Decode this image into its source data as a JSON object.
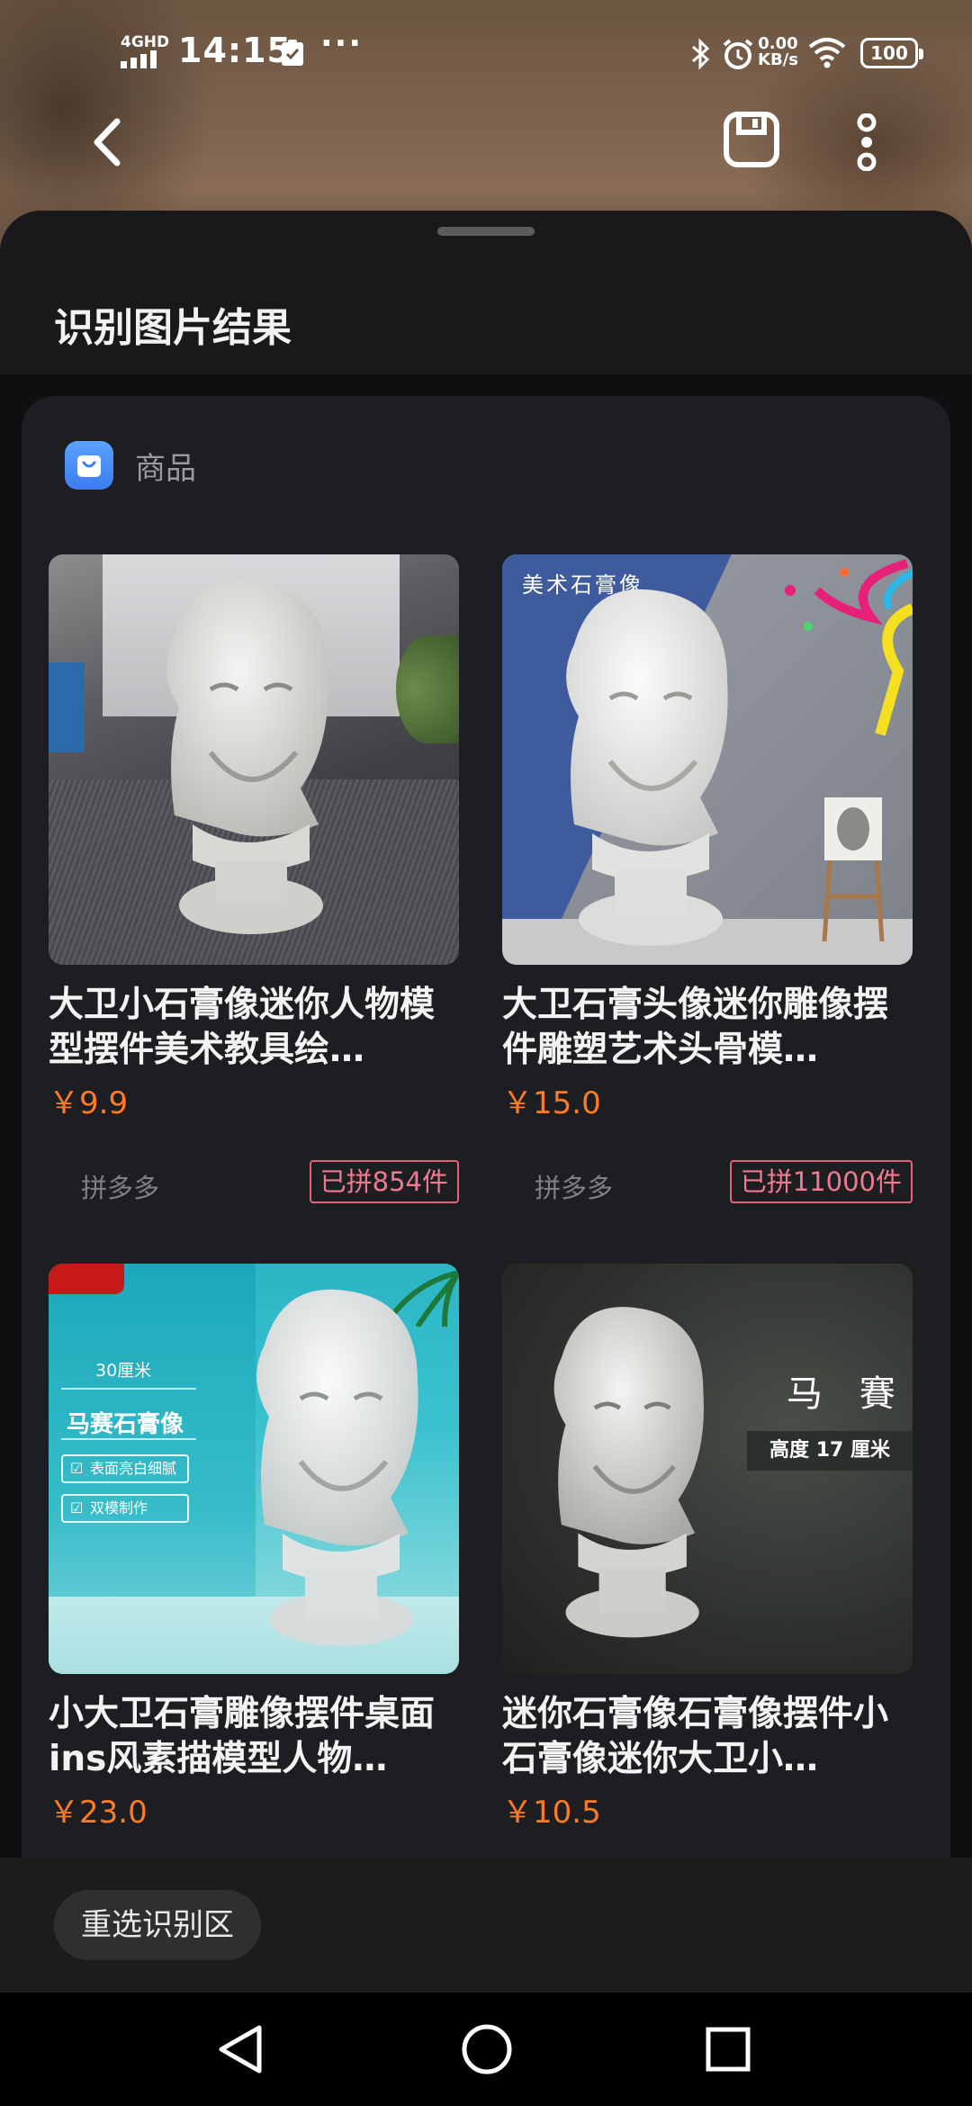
{
  "status_bar": {
    "network": "4GHD",
    "time": "14:15",
    "more": "···",
    "speed_value": "0.00",
    "speed_unit": "KB/s",
    "battery": "100"
  },
  "top_bar": {
    "back_icon": "chevron-left-icon",
    "save_icon": "save-icon",
    "more_icon": "more-vertical-icon"
  },
  "sheet": {
    "title": "识别图片结果",
    "category": {
      "icon": "shopping-bag-icon",
      "label": "商品"
    }
  },
  "products": [
    {
      "title": "大卫小石膏像迷你人物模型摆件美术教具绘…",
      "price": "￥9.9",
      "platform": "拼多多",
      "sold": "已拼854件"
    },
    {
      "title": "大卫石膏头像迷你雕像摆件雕塑艺术头骨模…",
      "price": "￥15.0",
      "platform": "拼多多",
      "sold": "已拼11000件",
      "image_text": "美术石膏像"
    },
    {
      "title": "小大卫石膏雕像摆件桌面ins风素描模型人物…",
      "price": "￥23.0",
      "image_text": {
        "size": "30厘米",
        "name": "马赛石膏像",
        "feature1": "表面亮白细腻",
        "feature2": "双模制作"
      }
    },
    {
      "title": "迷你石膏像石膏像摆件小石膏像迷你大卫小…",
      "price": "￥10.5",
      "image_text": {
        "name": "马 賽",
        "height": "高度 17 厘米"
      }
    }
  ],
  "bottom": {
    "reselect_label": "重选识别区"
  },
  "nav_bar": {
    "back_icon": "triangle-back-icon",
    "home_icon": "circle-home-icon",
    "recent_icon": "square-recent-icon"
  },
  "colors": {
    "price": "#ff7a22",
    "sold_badge": "#e8607a",
    "category_icon": "#3b7df2",
    "sheet_bg": "#0f0f11",
    "card_bg": "#1d1e21"
  }
}
